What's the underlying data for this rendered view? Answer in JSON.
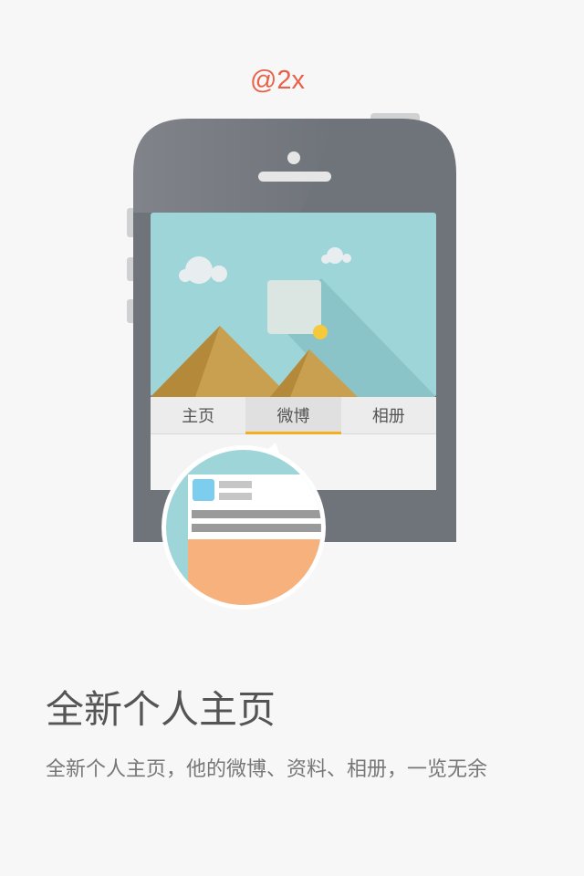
{
  "scale_label": "@2x",
  "tabs": [
    {
      "label": "主页"
    },
    {
      "label": "微博"
    },
    {
      "label": "相册"
    }
  ],
  "active_tab": "微博",
  "title": "全新个人主页",
  "subtitle": "全新个人主页，他的微博、资料、相册，一览无余",
  "colors": {
    "background": "#f7f7f7",
    "phone_body": "#6f737a",
    "sky": "#9dd5d9",
    "sand_light": "#c9a04f",
    "sand_dark": "#b5893a",
    "sun": "#f5c93b",
    "tab_indicator": "#f2b01e",
    "card_avatar": "#7dcdef",
    "card_image": "#f6b17c",
    "scale_label": "#e8624a"
  }
}
